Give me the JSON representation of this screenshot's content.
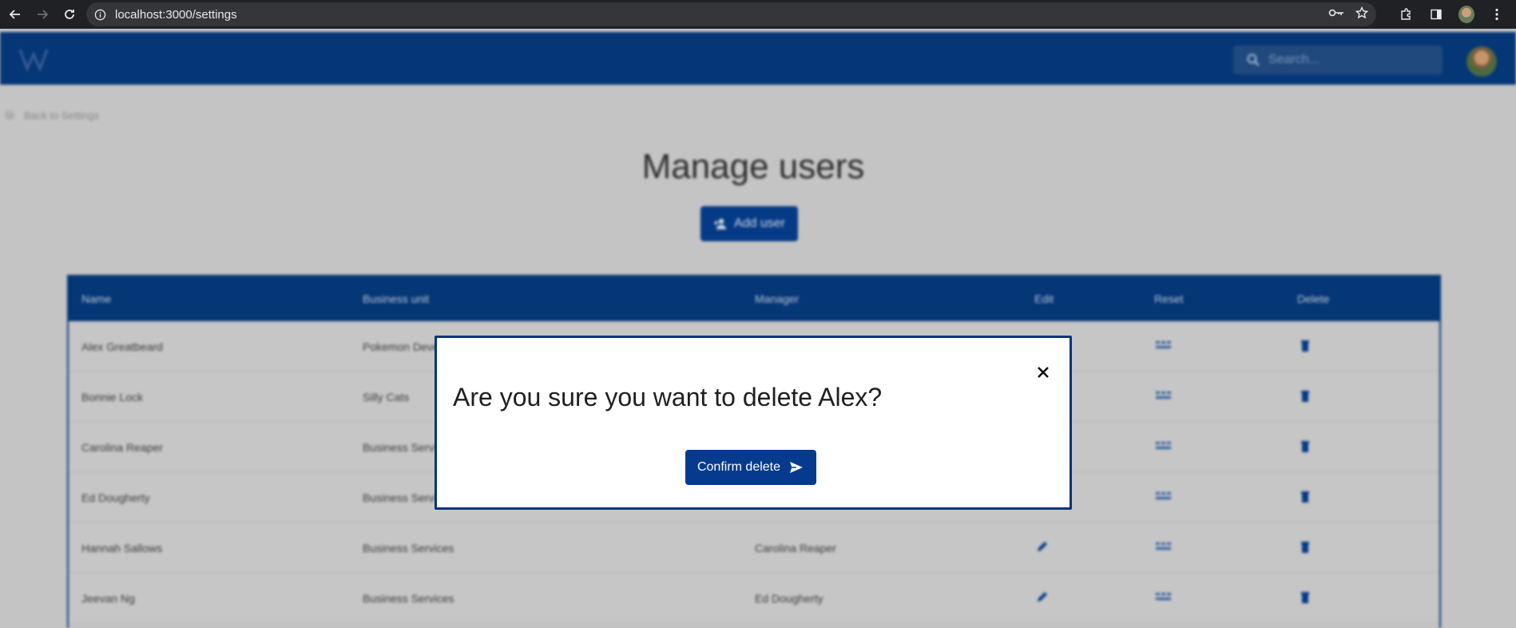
{
  "browser": {
    "url": "localhost:3000/settings"
  },
  "header": {
    "search_placeholder": "Search..."
  },
  "page": {
    "back_label": "Back to Settings",
    "title": "Manage users",
    "add_user_label": "Add user"
  },
  "table": {
    "columns": [
      "Name",
      "Business unit",
      "Manager",
      "Edit",
      "Reset",
      "Delete"
    ],
    "rows": [
      {
        "name": "Alex Greatbeard",
        "business_unit": "Pokemon Deve",
        "manager": "",
        "editable": false
      },
      {
        "name": "Bonnie Lock",
        "business_unit": "Silly Cats",
        "manager": "",
        "editable": false
      },
      {
        "name": "Carolina Reaper",
        "business_unit": "Business Servi",
        "manager": "",
        "editable": false
      },
      {
        "name": "Ed Dougherty",
        "business_unit": "Business Servi",
        "manager": "",
        "editable": false
      },
      {
        "name": "Hannah Sallows",
        "business_unit": "Business Services",
        "manager": "Carolina Reaper",
        "editable": true
      },
      {
        "name": "Jeevan Ng",
        "business_unit": "Business Services",
        "manager": "Ed Dougherty",
        "editable": true
      }
    ]
  },
  "modal": {
    "title": "Are you sure you want to delete Alex?",
    "confirm_label": "Confirm delete"
  },
  "colors": {
    "brand": "#053676",
    "button": "#053a8e"
  }
}
